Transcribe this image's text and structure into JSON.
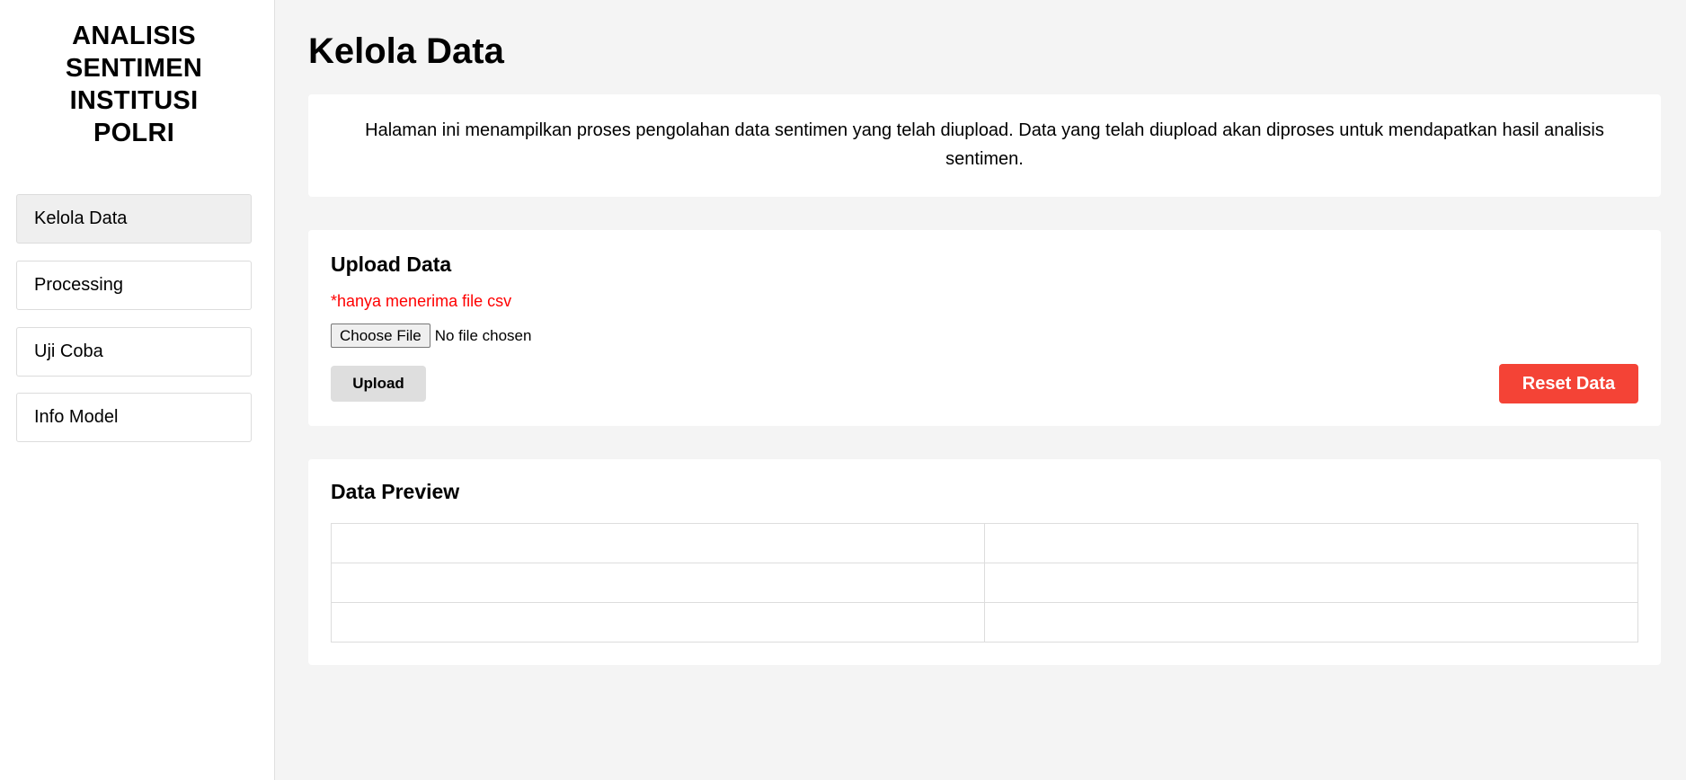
{
  "sidebar": {
    "title": "ANALISIS\nSENTIMEN\nINSTITUSI\nPOLRI",
    "items": [
      {
        "label": "Kelola Data",
        "active": true
      },
      {
        "label": "Processing",
        "active": false
      },
      {
        "label": "Uji Coba",
        "active": false
      },
      {
        "label": "Info Model",
        "active": false
      }
    ]
  },
  "main": {
    "page_title": "Kelola Data",
    "intro_text": "Halaman ini menampilkan proses pengolahan data sentimen yang telah diupload. Data yang telah diupload akan diproses untuk mendapatkan hasil analisis sentimen.",
    "upload": {
      "title": "Upload Data",
      "note": "*hanya menerima file csv",
      "choose_file_label": "Choose File",
      "file_status": "No file chosen",
      "upload_label": "Upload",
      "reset_label": "Reset Data"
    },
    "preview": {
      "title": "Data Preview",
      "rows": [
        [
          "",
          ""
        ],
        [
          "",
          ""
        ],
        [
          "",
          ""
        ]
      ]
    }
  },
  "colors": {
    "reset_button": "#f44336",
    "note_text": "#ff0000",
    "page_background": "#f4f4f4"
  }
}
